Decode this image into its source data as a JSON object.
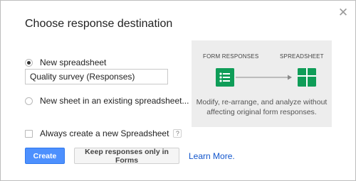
{
  "dialog": {
    "title": "Choose response destination",
    "close_icon": "close-icon"
  },
  "options": {
    "new_spreadsheet_label": "New spreadsheet",
    "new_spreadsheet_selected": true,
    "spreadsheet_name_value": "Quality survey (Responses)",
    "existing_sheet_label": "New sheet in an existing spreadsheet...",
    "always_create_label": "Always create a new Spreadsheet",
    "always_create_checked": false,
    "help_glyph": "?"
  },
  "illustration": {
    "form_label": "FORM RESPONSES",
    "sheet_label": "SPREADSHEET",
    "description": "Modify, re-arrange, and analyze without affecting original form responses.",
    "form_icon": "form-responses-icon",
    "sheet_icon": "spreadsheet-icon",
    "arrow_icon": "arrow-right-icon",
    "colors": {
      "panel_bg": "#ededed",
      "green": "#0f9d58"
    }
  },
  "actions": {
    "create_label": "Create",
    "keep_label": "Keep responses only in Forms",
    "learn_more_label": "Learn More.",
    "colors": {
      "primary": "#4d90fe",
      "link": "#1155cc"
    }
  }
}
